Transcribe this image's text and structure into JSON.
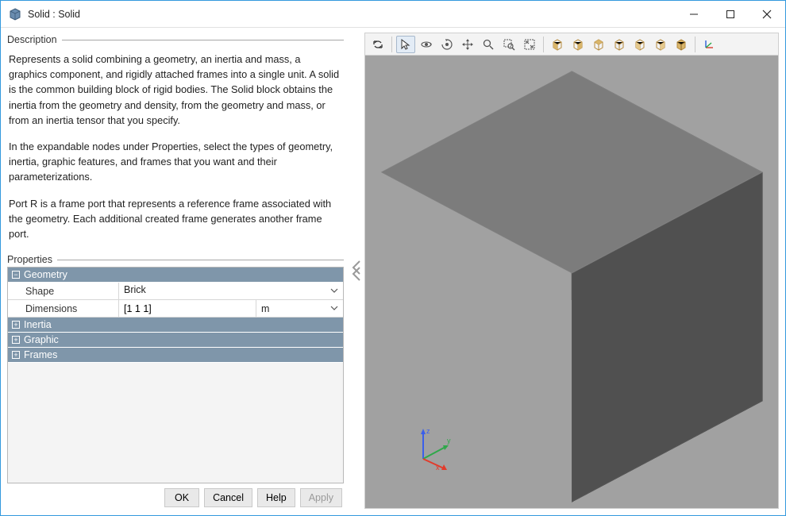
{
  "title": "Solid : Solid",
  "left": {
    "description_label": "Description",
    "properties_label": "Properties",
    "description": {
      "p1": "Represents a solid combining a geometry, an inertia and mass, a graphics component, and rigidly attached frames into a single unit. A solid is the common building block of rigid bodies. The Solid block obtains the inertia from the geometry and density, from the geometry and mass, or from an inertia tensor that you specify.",
      "p2": "In the expandable nodes under Properties, select the types of geometry, inertia, graphic features, and frames that you want and their parameterizations.",
      "p3": "Port R is a frame port that represents a reference frame associated with the geometry. Each additional created frame generates another frame port."
    },
    "sections": {
      "geometry": {
        "label": "Geometry",
        "expanded": true,
        "shape_label": "Shape",
        "shape_value": "Brick",
        "dim_label": "Dimensions",
        "dim_value": "[1 1 1]",
        "dim_unit": "m"
      },
      "inertia": {
        "label": "Inertia",
        "expanded": false
      },
      "graphic": {
        "label": "Graphic",
        "expanded": false
      },
      "frames": {
        "label": "Frames",
        "expanded": false
      }
    },
    "buttons": {
      "ok": "OK",
      "cancel": "Cancel",
      "help": "Help",
      "apply": "Apply"
    }
  },
  "toolbar_icons": [
    "update-icon",
    "select-icon",
    "orbit-icon",
    "spin-icon",
    "pan-icon",
    "zoom-icon",
    "zoom-region-icon",
    "fit-view-icon",
    "view-front-icon",
    "view-back-icon",
    "view-top-icon",
    "view-bottom-icon",
    "view-left-icon",
    "view-right-icon",
    "view-iso-icon",
    "triad-icon"
  ],
  "axis_triad": {
    "x": "x",
    "y": "y",
    "z": "z"
  }
}
